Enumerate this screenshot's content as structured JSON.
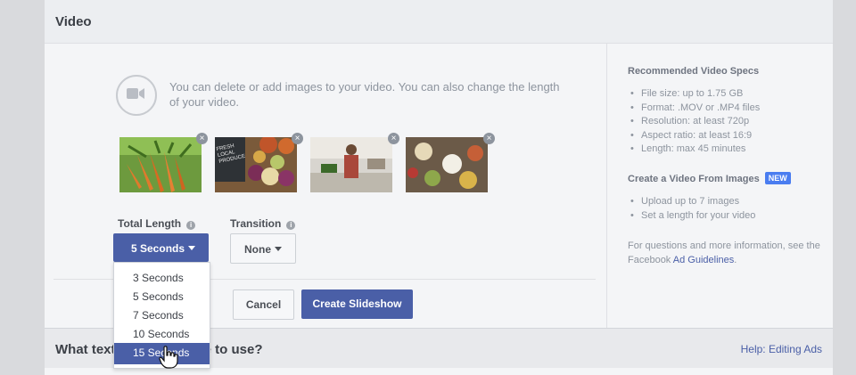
{
  "section": {
    "title": "Video"
  },
  "intro": {
    "icon": "video-camera-icon",
    "text": "You can delete or add images to your video. You can also change the length of your video."
  },
  "thumbnails": [
    {
      "name": "carrots-image",
      "remove": "×"
    },
    {
      "name": "fresh-local-produce-image",
      "sign_text": "FRESH LOCAL PRODUCE",
      "remove": "×"
    },
    {
      "name": "kitchen-woman-image",
      "remove": "×"
    },
    {
      "name": "table-food-image",
      "remove": "×"
    }
  ],
  "total_length": {
    "label": "Total Length",
    "value": "5 Seconds",
    "options": [
      "3 Seconds",
      "5 Seconds",
      "7 Seconds",
      "10 Seconds",
      "15 Seconds"
    ],
    "highlighted": "15 Seconds"
  },
  "transition": {
    "label": "Transition",
    "value": "None"
  },
  "buttons": {
    "cancel": "Cancel",
    "create": "Create Slideshow"
  },
  "sidebar": {
    "specs_title": "Recommended Video Specs",
    "specs": [
      "File size: up to 1.75 GB",
      "Format: .MOV or .MP4 files",
      "Resolution: at least 720p",
      "Aspect ratio: at least 16:9",
      "Length: max 45 minutes"
    ],
    "images_title": "Create a Video From Images",
    "badge": "NEW",
    "images_items": [
      "Upload up to 7 images",
      "Set a length for your video"
    ],
    "note_prefix": "For questions and more information, see the Facebook ",
    "note_link": "Ad Guidelines",
    "note_suffix": "."
  },
  "next_section": {
    "question": "What text would you like to use?",
    "help": "Help: Editing Ads"
  },
  "colors": {
    "accent": "#4a5fa7",
    "new_badge": "#4a7df0"
  }
}
